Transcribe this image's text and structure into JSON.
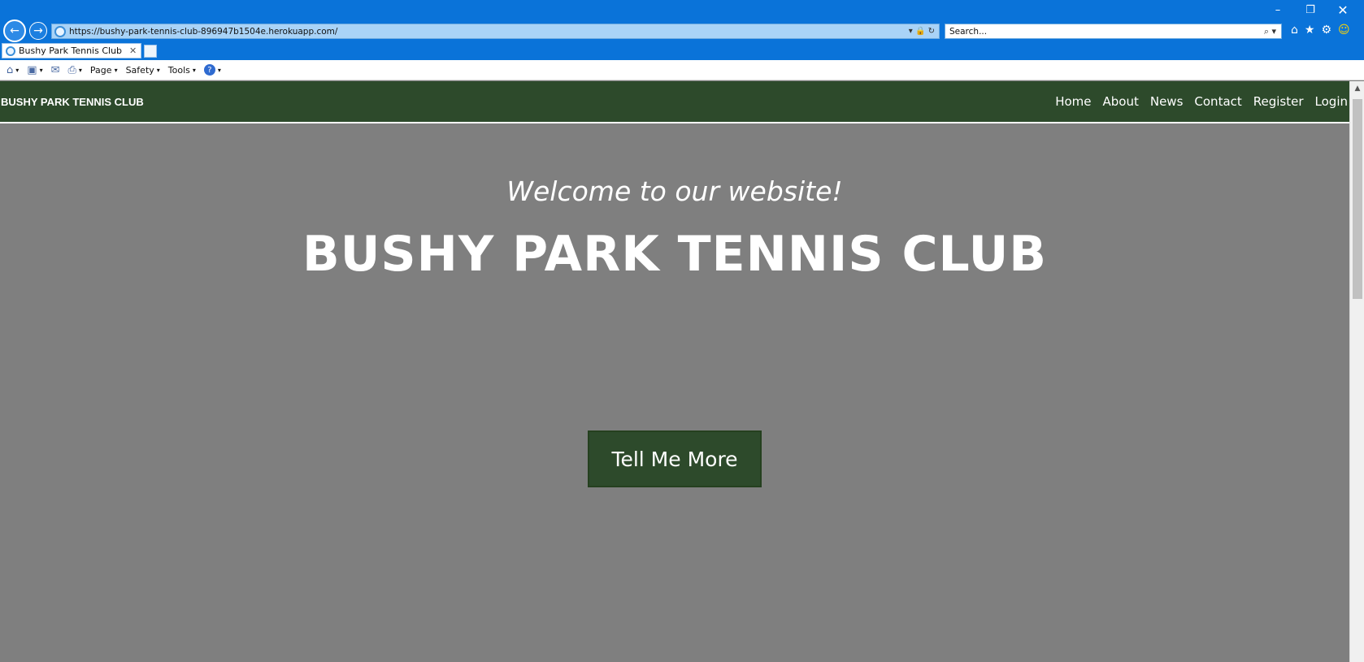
{
  "browser": {
    "window_controls": {
      "minimize": "–",
      "maximize": "❐",
      "close": "✕"
    },
    "back_icon": "←",
    "forward_icon": "→",
    "url": "https://bushy-park-tennis-club-896947b1504e.herokuapp.com/",
    "address_tools": "▾ 🔒 ↻",
    "search_placeholder": "Search...",
    "search_tools": "⌕ ▾",
    "right_icons": {
      "home": "⌂",
      "favorites": "★",
      "settings": "⚙",
      "feedback": "☺"
    },
    "tab_title": "Bushy Park Tennis Club",
    "tab_close": "✕",
    "command_bar": {
      "home_icon": "⌂",
      "feeds_icon": "▣",
      "mail_icon": "✉",
      "print_icon": "⎙",
      "page_label": "Page",
      "safety_label": "Safety",
      "tools_label": "Tools",
      "help_icon": "?",
      "caret": "▾"
    }
  },
  "site": {
    "brand": "BUSHY PARK TENNIS CLUB",
    "nav": [
      "Home",
      "About",
      "News",
      "Contact",
      "Register",
      "Login"
    ],
    "hero": {
      "welcome": "Welcome to our website!",
      "headline": "BUSHY PARK TENNIS CLUB",
      "cta_label": "Tell Me More"
    },
    "colors": {
      "nav_background": "#2d4a2b",
      "hero_background": "#7f7f7f",
      "button_background": "#2d4a2b",
      "browser_chrome": "#0a73d9"
    }
  },
  "scrollbar": {
    "up_arrow": "▲"
  }
}
